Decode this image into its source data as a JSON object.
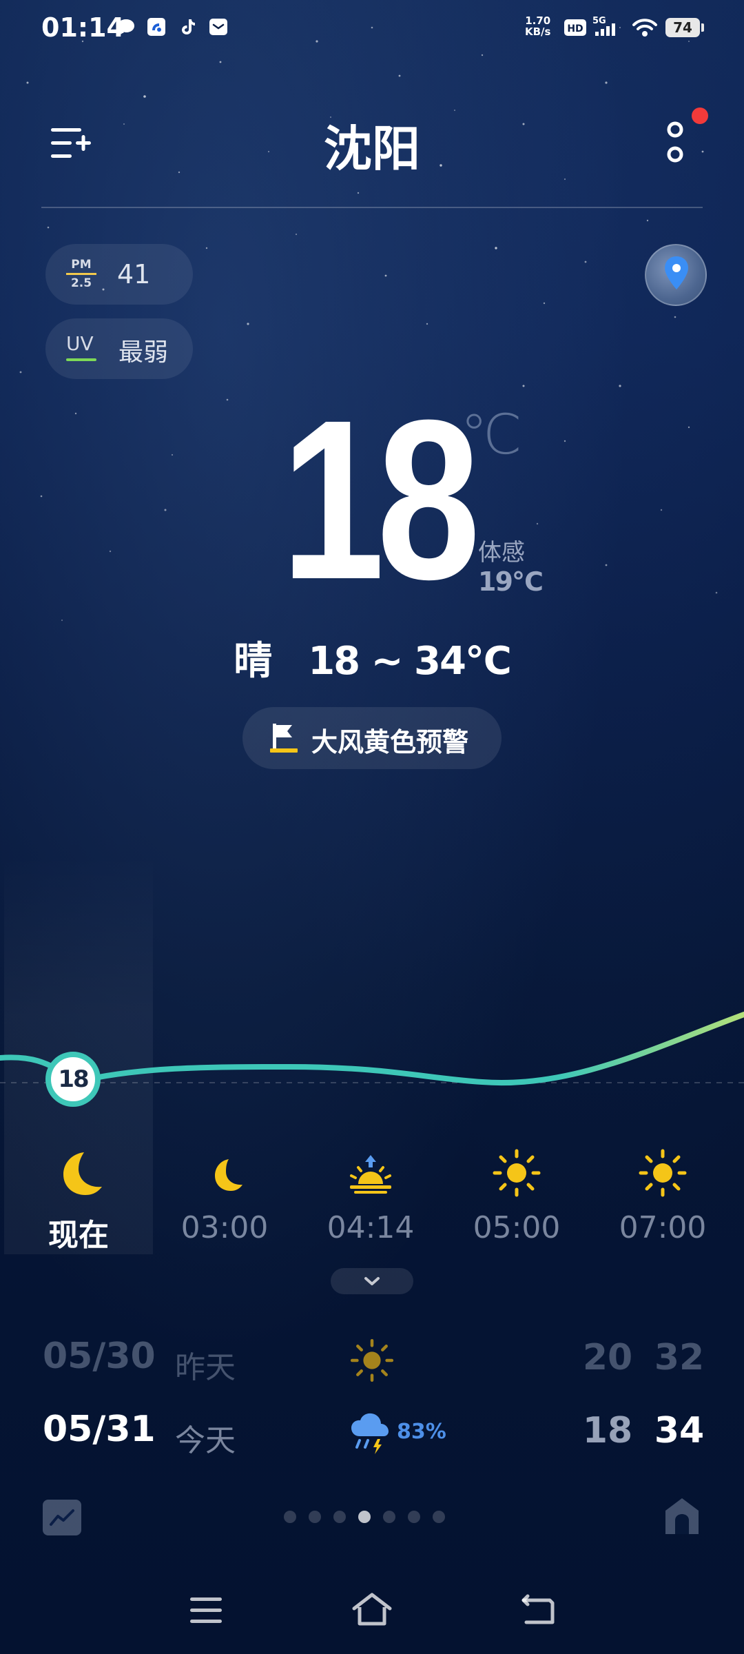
{
  "status_bar": {
    "time": "01:14",
    "net_speed_value": "1.70",
    "net_speed_unit": "KB/s",
    "hd_label": "HD",
    "network_label": "5G",
    "battery": "74"
  },
  "header": {
    "city": "沈阳"
  },
  "air": {
    "pm_top": "PM",
    "pm_bottom": "2.5",
    "pm_value": "41",
    "uv_label": "UV",
    "uv_value": "最弱"
  },
  "current": {
    "temperature": "18",
    "unit": "℃",
    "feels_label": "体感",
    "feels_value": "19℃",
    "condition": "晴",
    "range": "18 ~ 34℃",
    "alert": "大风黄色预警"
  },
  "hourly": {
    "now_bubble": "18",
    "items": [
      {
        "label": "现在",
        "icon": "moon-icon"
      },
      {
        "label": "03:00",
        "icon": "moon-icon"
      },
      {
        "label": "04:14",
        "icon": "sunrise-icon"
      },
      {
        "label": "05:00",
        "icon": "sun-icon"
      },
      {
        "label": "07:00",
        "icon": "sun-icon"
      }
    ]
  },
  "daily": [
    {
      "date": "05/30",
      "name": "昨天",
      "icon": "sun-icon",
      "precip": "",
      "low": "20",
      "high": "32"
    },
    {
      "date": "05/31",
      "name": "今天",
      "icon": "rain-thunder-icon",
      "precip": "83%",
      "low": "18",
      "high": "34"
    }
  ],
  "pager": {
    "count": 7,
    "active_index": 3
  },
  "colors": {
    "curve": "#3ec7b8",
    "sun": "#f5c518",
    "alert_flag": "#f5c518",
    "precip": "#4d8fe8",
    "notification_dot": "#f23a3a"
  }
}
